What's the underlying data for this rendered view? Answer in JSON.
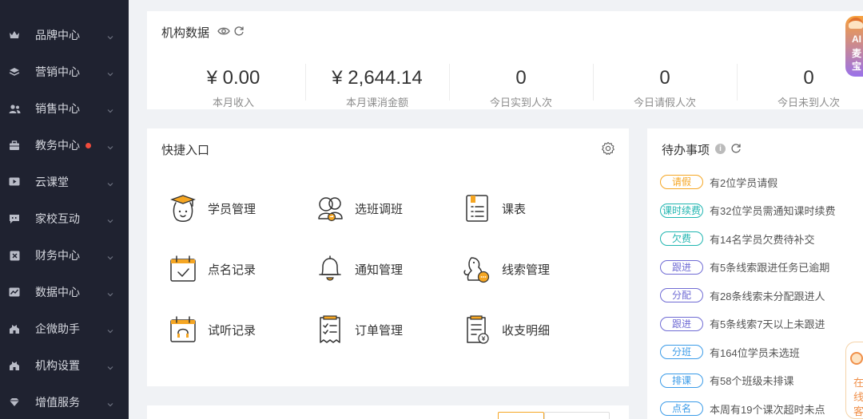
{
  "sidebar": {
    "items": [
      {
        "label": "品牌中心",
        "icon": "crown-icon",
        "badge": false
      },
      {
        "label": "营销中心",
        "icon": "layers-icon",
        "badge": false
      },
      {
        "label": "销售中心",
        "icon": "users-icon",
        "badge": false
      },
      {
        "label": "教务中心",
        "icon": "briefcase-icon",
        "badge": true
      },
      {
        "label": "云课堂",
        "icon": "play-icon",
        "badge": false
      },
      {
        "label": "家校互动",
        "icon": "chat-icon",
        "badge": false
      },
      {
        "label": "财务中心",
        "icon": "finance-icon",
        "badge": false
      },
      {
        "label": "数据中心",
        "icon": "chart-icon",
        "badge": false
      },
      {
        "label": "企微助手",
        "icon": "building-icon",
        "badge": false
      },
      {
        "label": "机构设置",
        "icon": "building-icon",
        "badge": false
      },
      {
        "label": "增值服务",
        "icon": "diamond-icon",
        "badge": false
      }
    ],
    "badge_color": "#f04b3c"
  },
  "org_data": {
    "title": "机构数据",
    "stats": [
      {
        "value": "¥ 0.00",
        "label": "本月收入"
      },
      {
        "value": "¥ 2,644.14",
        "label": "本月课消金额"
      },
      {
        "value": "0",
        "label": "今日实到人次"
      },
      {
        "value": "0",
        "label": "今日请假人次"
      },
      {
        "value": "0",
        "label": "今日未到人次"
      }
    ]
  },
  "quick": {
    "title": "快捷入口",
    "items": [
      {
        "label": "学员管理",
        "icon": "student-icon"
      },
      {
        "label": "选班调班",
        "icon": "class-switch-icon"
      },
      {
        "label": "课表",
        "icon": "schedule-icon"
      },
      {
        "label": "点名记录",
        "icon": "roll-call-icon"
      },
      {
        "label": "通知管理",
        "icon": "bell-icon"
      },
      {
        "label": "线索管理",
        "icon": "lead-icon"
      },
      {
        "label": "试听记录",
        "icon": "trial-icon"
      },
      {
        "label": "订单管理",
        "icon": "order-icon"
      },
      {
        "label": "收支明细",
        "icon": "ledger-icon"
      }
    ]
  },
  "todo": {
    "title": "待办事项",
    "items": [
      {
        "tag": "请假",
        "desc": "有2位学员请假",
        "color": "#f5a623"
      },
      {
        "tag": "课时续费",
        "desc": "有32位学员需通知课时续费",
        "color": "#1fb5b0"
      },
      {
        "tag": "欠费",
        "desc": "有14名学员欠费待补交",
        "color": "#1fb5b0"
      },
      {
        "tag": "跟进",
        "desc": "有5条线索跟进任务已逾期",
        "color": "#6f6bd4"
      },
      {
        "tag": "分配",
        "desc": "有28条线索未分配跟进人",
        "color": "#6f6bd4"
      },
      {
        "tag": "跟进",
        "desc": "有5条线索7天以上未跟进",
        "color": "#6f6bd4"
      },
      {
        "tag": "分班",
        "desc": "有164位学员未选班",
        "color": "#3a9be8"
      },
      {
        "tag": "排课",
        "desc": "有58个班级未排课",
        "color": "#3a9be8"
      },
      {
        "tag": "点名",
        "desc": "本周有19个课次超时未点",
        "color": "#3a9be8"
      }
    ]
  },
  "ai_float": {
    "chars": [
      "AI",
      "麦",
      "宝"
    ]
  },
  "online_float": {
    "chars": [
      "在",
      "线",
      "客"
    ]
  },
  "colors": {
    "sidebar_bg": "#1f2230",
    "accent_orange": "#f5a623",
    "icon_stroke": "#333333"
  }
}
